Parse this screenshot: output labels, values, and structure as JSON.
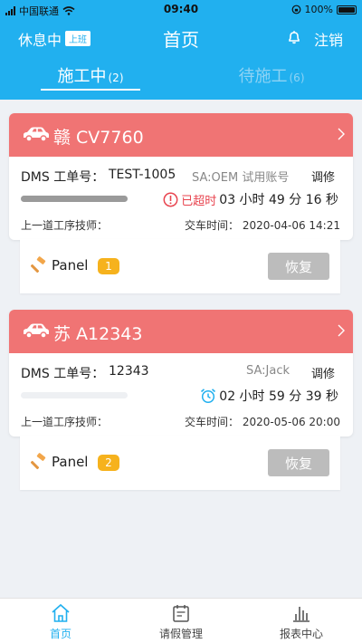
{
  "statusbar": {
    "carrier": "中国联通",
    "time": "09:40",
    "battery": "100%"
  },
  "nav": {
    "status_label": "休息中",
    "status_tag": "上班",
    "title": "首页",
    "logout": "注销"
  },
  "tabs": [
    {
      "label": "施工中",
      "count": "(2)",
      "active": true
    },
    {
      "label": "待施工",
      "count": "(6)",
      "active": false
    }
  ],
  "cards": [
    {
      "plate": "赣 CV7760",
      "dms_label": "DMS 工单号：",
      "dms_value": "TEST-1005",
      "sa": "SA:OEM 试用账号",
      "repair_type": "调修",
      "overdue_label": "已超时",
      "timer": "03 小时 49 分 16 秒",
      "progress": 1.0,
      "tech_label": "上一道工序技师：",
      "deliver_time": "交车时间：  2020-04-06 14:21",
      "panel_name": "Panel",
      "panel_count": "1",
      "restore_label": "恢复"
    },
    {
      "plate": "苏 A12343",
      "dms_label": "DMS 工单号：",
      "dms_value": "12343",
      "sa": "SA:Jack",
      "repair_type": "调修",
      "timer": "02 小时 59 分 39 秒",
      "progress": 0.0,
      "tech_label": "上一道工序技师：",
      "deliver_time": "交车时间：  2020-05-06 20:00",
      "panel_name": "Panel",
      "panel_count": "2",
      "restore_label": "恢复"
    }
  ],
  "tabbar": [
    {
      "label": "首页",
      "icon": "home-icon",
      "active": true
    },
    {
      "label": "请假管理",
      "icon": "calendar-icon",
      "active": false
    },
    {
      "label": "报表中心",
      "icon": "chart-icon",
      "active": false
    }
  ],
  "colors": {
    "primary": "#21b0ef",
    "card_header": "#f07474",
    "badge": "#f6b21d",
    "overdue": "#e8434e"
  }
}
